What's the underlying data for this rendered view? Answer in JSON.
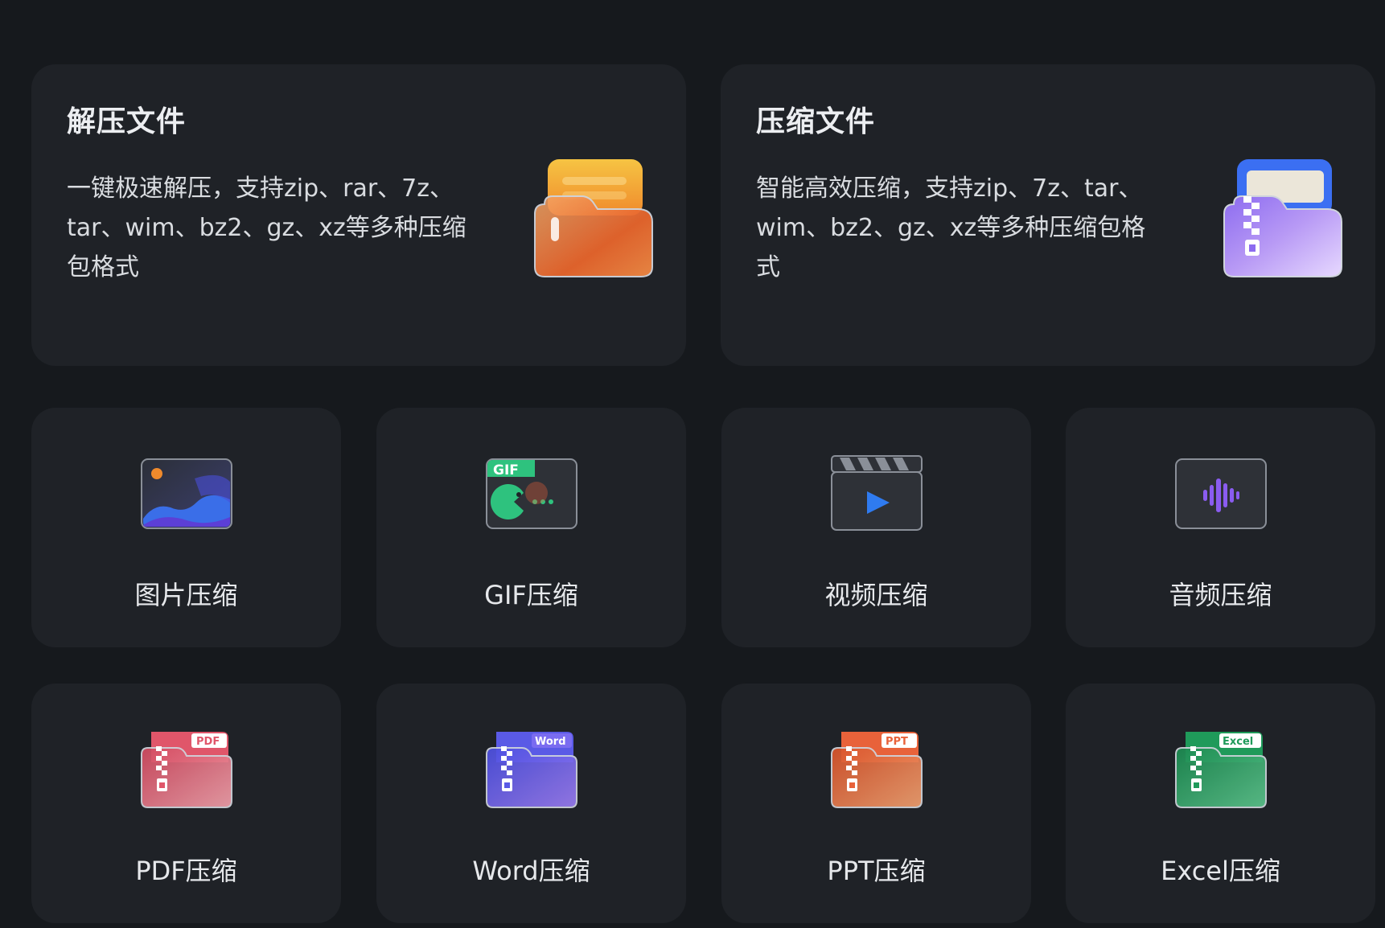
{
  "feature_cards": [
    {
      "title": "解压文件",
      "description": "一键极速解压，支持zip、rar、7z、tar、wim、bz2、gz、xz等多种压缩包格式",
      "icon": "orange-folder-extract-icon"
    },
    {
      "title": "压缩文件",
      "description": "智能高效压缩，支持zip、7z、tar、wim、bz2、gz、xz等多种压缩包格式",
      "icon": "purple-zip-folder-icon"
    }
  ],
  "tools": [
    {
      "label": "图片压缩",
      "icon": "image-compress-icon"
    },
    {
      "label": "GIF压缩",
      "icon": "gif-compress-icon",
      "badge": "GIF"
    },
    {
      "label": "视频压缩",
      "icon": "video-compress-icon"
    },
    {
      "label": "音频压缩",
      "icon": "audio-compress-icon"
    },
    {
      "label": "PDF压缩",
      "icon": "pdf-compress-icon",
      "badge": "PDF"
    },
    {
      "label": "Word压缩",
      "icon": "word-compress-icon",
      "badge": "Word"
    },
    {
      "label": "PPT压缩",
      "icon": "ppt-compress-icon",
      "badge": "PPT"
    },
    {
      "label": "Excel压缩",
      "icon": "excel-compress-icon",
      "badge": "Excel"
    }
  ],
  "colors": {
    "background": "#16191d",
    "card": "#1f2227",
    "pdf": "#e0566a",
    "word": "#5a5ae6",
    "ppt": "#e8623a",
    "excel": "#1f9a5a",
    "gif": "#2ec27e"
  }
}
